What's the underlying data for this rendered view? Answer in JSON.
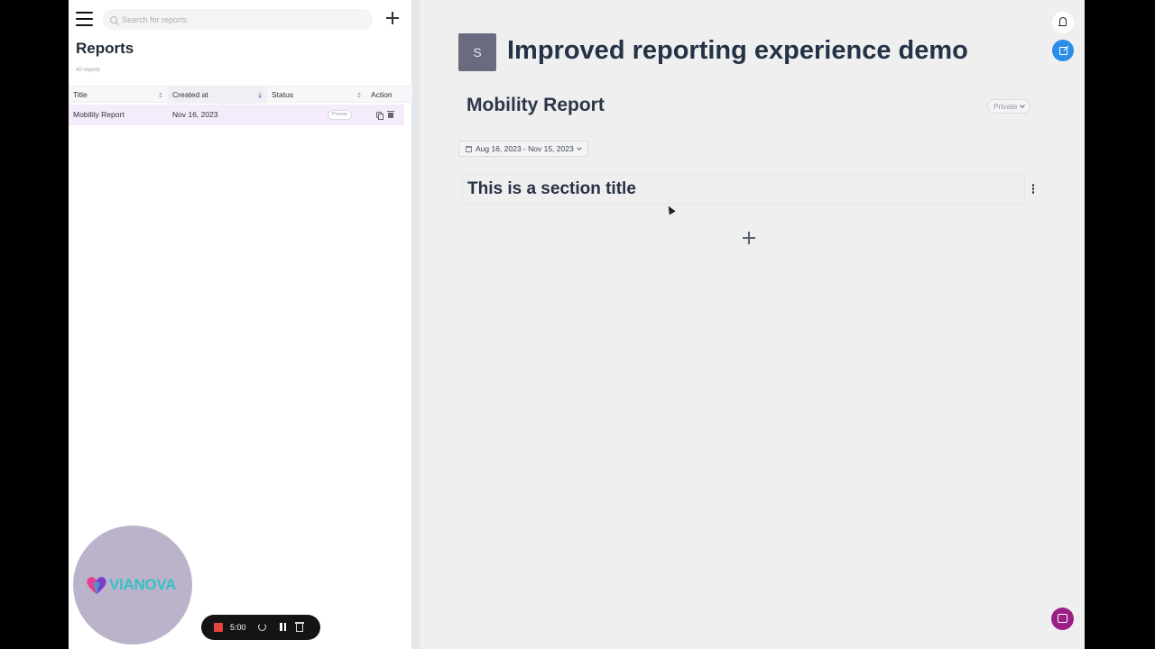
{
  "sidebar": {
    "search_placeholder": "Search for reports",
    "title": "Reports",
    "count": "40 reports",
    "columns": [
      "Title",
      "Created at",
      "Status",
      "Action"
    ],
    "rows": [
      {
        "title": "Mobility Report",
        "created_at": "Nov 16, 2023",
        "status": "Private"
      }
    ]
  },
  "main": {
    "avatar_letter": "S",
    "page_title": "Improved reporting experience demo",
    "report_name": "Mobility Report",
    "visibility": "Private",
    "date_range": "Aug 16, 2023 - Nov 15, 2023",
    "section_title": "This is a section title"
  },
  "overlay": {
    "brand": "VIANOVA",
    "rec_time": "5:00"
  },
  "colors": {
    "accent_blue": "#2a8de8",
    "chat_purple": "#9c1f86",
    "row_highlight": "#f4ecfb",
    "rec_red": "#e5453d"
  },
  "icons": [
    "menu-icon",
    "search-icon",
    "plus-icon",
    "sort-icon",
    "copy-icon",
    "trash-icon",
    "calendar-icon",
    "chevron-down-icon",
    "kebab-icon",
    "bell-icon",
    "external-link-icon",
    "chat-icon",
    "stop-icon",
    "restart-icon",
    "pause-icon",
    "delete-icon"
  ]
}
